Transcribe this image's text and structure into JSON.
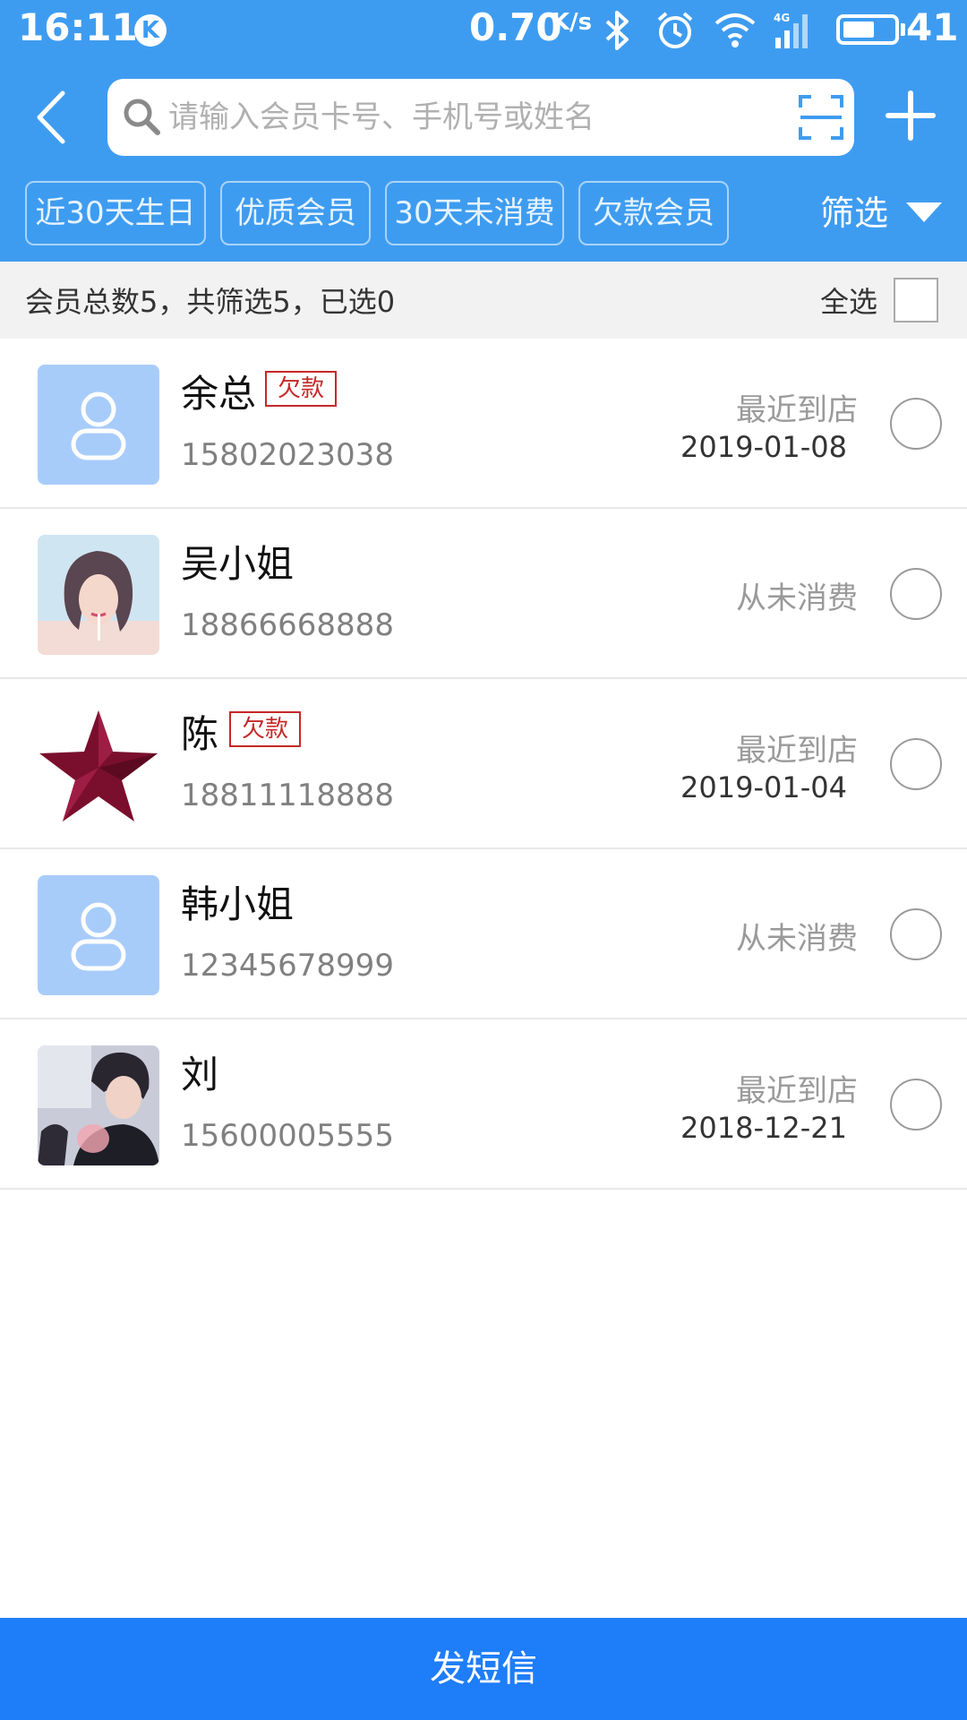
{
  "status_bar": {
    "time": "16:11",
    "k_badge": "K",
    "speed": "0.70",
    "speed_unit": "K/s",
    "network": "4G",
    "battery_level": "41"
  },
  "header": {
    "search": {
      "placeholder": "请输入会员卡号、手机号或姓名",
      "value": ""
    },
    "chips": [
      "近30天生日",
      "优质会员",
      "30天未消费",
      "欠款会员"
    ],
    "filter_label": "筛选"
  },
  "summary": {
    "text": "会员总数5，共筛选5，已选0",
    "select_all_label": "全选"
  },
  "members": [
    {
      "name": "余总",
      "tag": "欠款",
      "phone": "15802023038",
      "visit_label": "最近到店",
      "visit_date": "2019-01-08",
      "avatar": "placeholder-avatar-icon"
    },
    {
      "name": "吴小姐",
      "tag": "",
      "phone": "18866668888",
      "visit_label": "从未消费",
      "visit_date": "",
      "avatar": "photo-woman"
    },
    {
      "name": "陈",
      "tag": "欠款",
      "phone": "18811118888",
      "visit_label": "最近到店",
      "visit_date": "2019-01-04",
      "avatar": "star-icon"
    },
    {
      "name": "韩小姐",
      "tag": "",
      "phone": "12345678999",
      "visit_label": "从未消费",
      "visit_date": "",
      "avatar": "placeholder-avatar-icon"
    },
    {
      "name": "刘",
      "tag": "",
      "phone": "15600005555",
      "visit_label": "最近到店",
      "visit_date": "2018-12-21",
      "avatar": "photo-man"
    }
  ],
  "bottom_button": "发短信",
  "colors": {
    "header_blue": "#3e9cf0",
    "button_blue": "#1e7df8",
    "debt_red": "#c62828",
    "placeholder_avatar_bg": "#a8ccfa",
    "star_color": "#7a0f2d"
  }
}
